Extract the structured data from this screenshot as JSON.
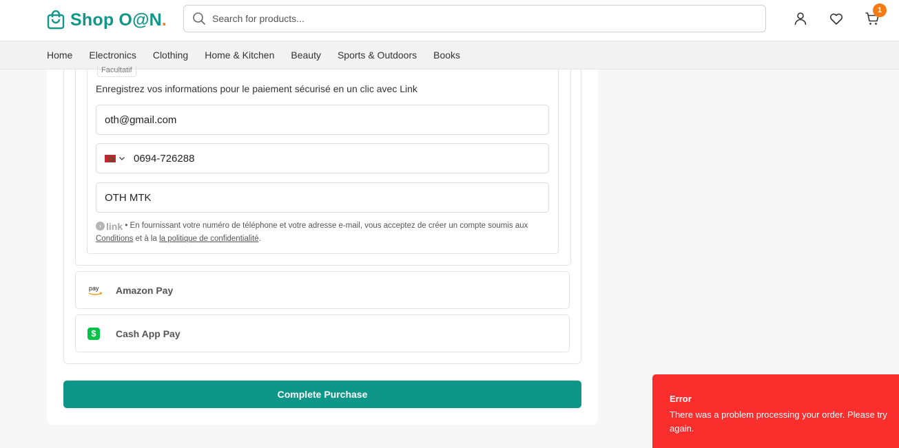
{
  "header": {
    "logo_text": "Shop O@N",
    "logo_dot": ".",
    "search_placeholder": "Search for products...",
    "cart_count": "1",
    "brand_color": "#10978a",
    "accent_color": "#f47c12"
  },
  "nav": {
    "items": [
      "Home",
      "Electronics",
      "Clothing",
      "Home & Kitchen",
      "Beauty",
      "Sports & Outdoors",
      "Books"
    ]
  },
  "payment": {
    "optional_tag": "Facultatif",
    "link_description": "Enregistrez vos informations pour le paiement sécurisé en un clic avec Link",
    "email_value": "oth@gmail.com",
    "phone_value": "0694-726288",
    "phone_country": "MA",
    "name_value": "OTH MTK",
    "link_brand": "link",
    "legal_text": " • En fournissant votre numéro de téléphone et votre adresse e-mail, vous acceptez de créer un compte soumis aux ",
    "conditions_link": "Conditions",
    "legal_mid": " et à la ",
    "privacy_link": "la politique de confidentialité",
    "legal_end": ".",
    "methods": [
      "Amazon Pay",
      "Cash App Pay"
    ]
  },
  "actions": {
    "complete_label": "Complete Purchase"
  },
  "toast": {
    "title": "Error",
    "message": "There was a problem processing your order. Please try again.",
    "color": "#fb2e2e"
  }
}
